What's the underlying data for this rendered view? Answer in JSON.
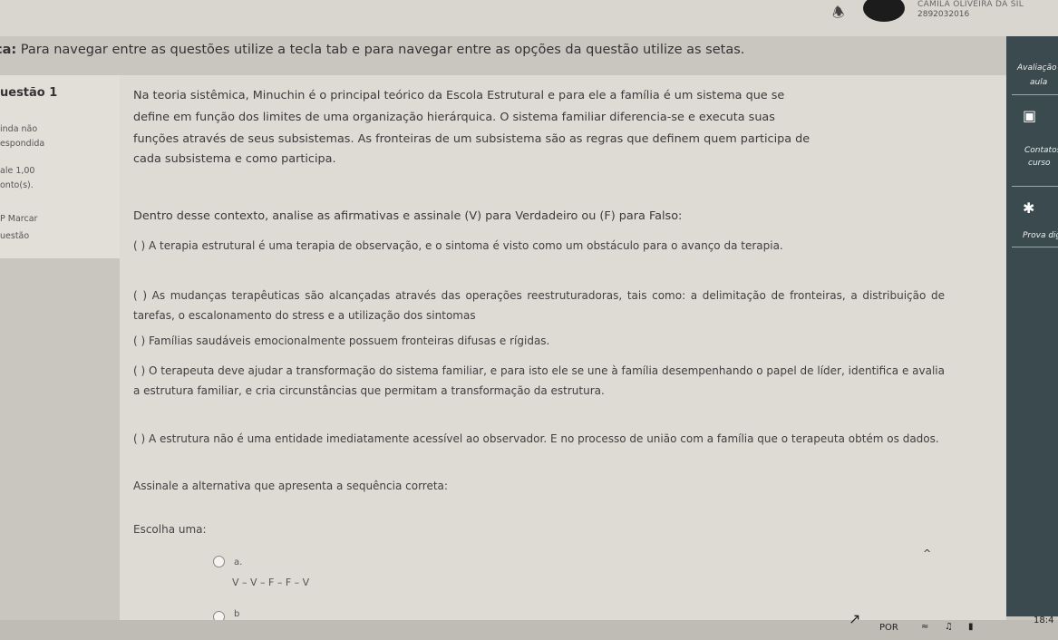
{
  "header": {
    "user_name": "CAMILA OLIVEIRA DA SIL",
    "user_id": "2892032016"
  },
  "nav_hint": {
    "prefix": "ca:",
    "text": " Para navegar entre as questões utilize a tecla tab e para navegar entre as opções da questão utilize as setas."
  },
  "question_info": {
    "title": "uestão 1",
    "status_line1": "inda não",
    "status_line2": "espondida",
    "value": "ale 1,00",
    "points": "onto(s).",
    "mark_label": "Marcar",
    "mark_label2": "uestão"
  },
  "question": {
    "intro_lines": [
      "Na teoria sistêmica, Minuchin é o principal teórico da Escola Estrutural e para ele a família é um sistema que se",
      "define em função dos limites de uma organização hierárquica. O sistema familiar diferencia-se e executa suas",
      "funções através de seus subsistemas. As fronteiras de um subsistema são as regras que definem quem participa de",
      "cada subsistema e como participa."
    ],
    "prompt": "Dentro desse contexto, analise as afirmativas e assinale (V) para Verdadeiro ou (F) para Falso:",
    "statements": [
      "(   ) A terapia estrutural é uma terapia de observação, e o sintoma é visto como um obstáculo para o avanço da terapia.",
      "(  ) As mudanças terapêuticas são alcançadas através das operações reestruturadoras, tais como: a delimitação de fronteiras, a distribuição de tarefas, o escalonamento do stress e a utilização dos sintomas",
      "(  ) Famílias saudáveis emocionalmente possuem fronteiras difusas e rígidas.",
      "(  ) O terapeuta deve ajudar a transformação do sistema familiar, e para isto ele se une à família desempenhando o papel de líder, identifica e avalia a estrutura familiar, e cria circunstâncias que permitam a transformação da estrutura.",
      "(  ) A estrutura não é uma entidade imediatamente acessível ao observador. E no processo de união com a família que o terapeuta obtém os dados."
    ],
    "instruction": "Assinale a alternativa que apresenta a sequência correta:",
    "choose_label": "Escolha uma:",
    "options": [
      {
        "letter": "a.",
        "text": "V – V – F – F – V"
      },
      {
        "letter": "b",
        "text": ""
      }
    ]
  },
  "right_panel": {
    "avaliacao": "Avaliação",
    "aulas": "aula",
    "contatos": "Contatos",
    "curso": "curso",
    "prova": "Prova digi"
  },
  "taskbar": {
    "language": "POR",
    "time": "18:4"
  },
  "icons": [
    "bell-icon",
    "avatar",
    "chat-icon",
    "gear-icon",
    "cursor-icon",
    "wifi-icon",
    "volume-icon",
    "battery-icon"
  ]
}
